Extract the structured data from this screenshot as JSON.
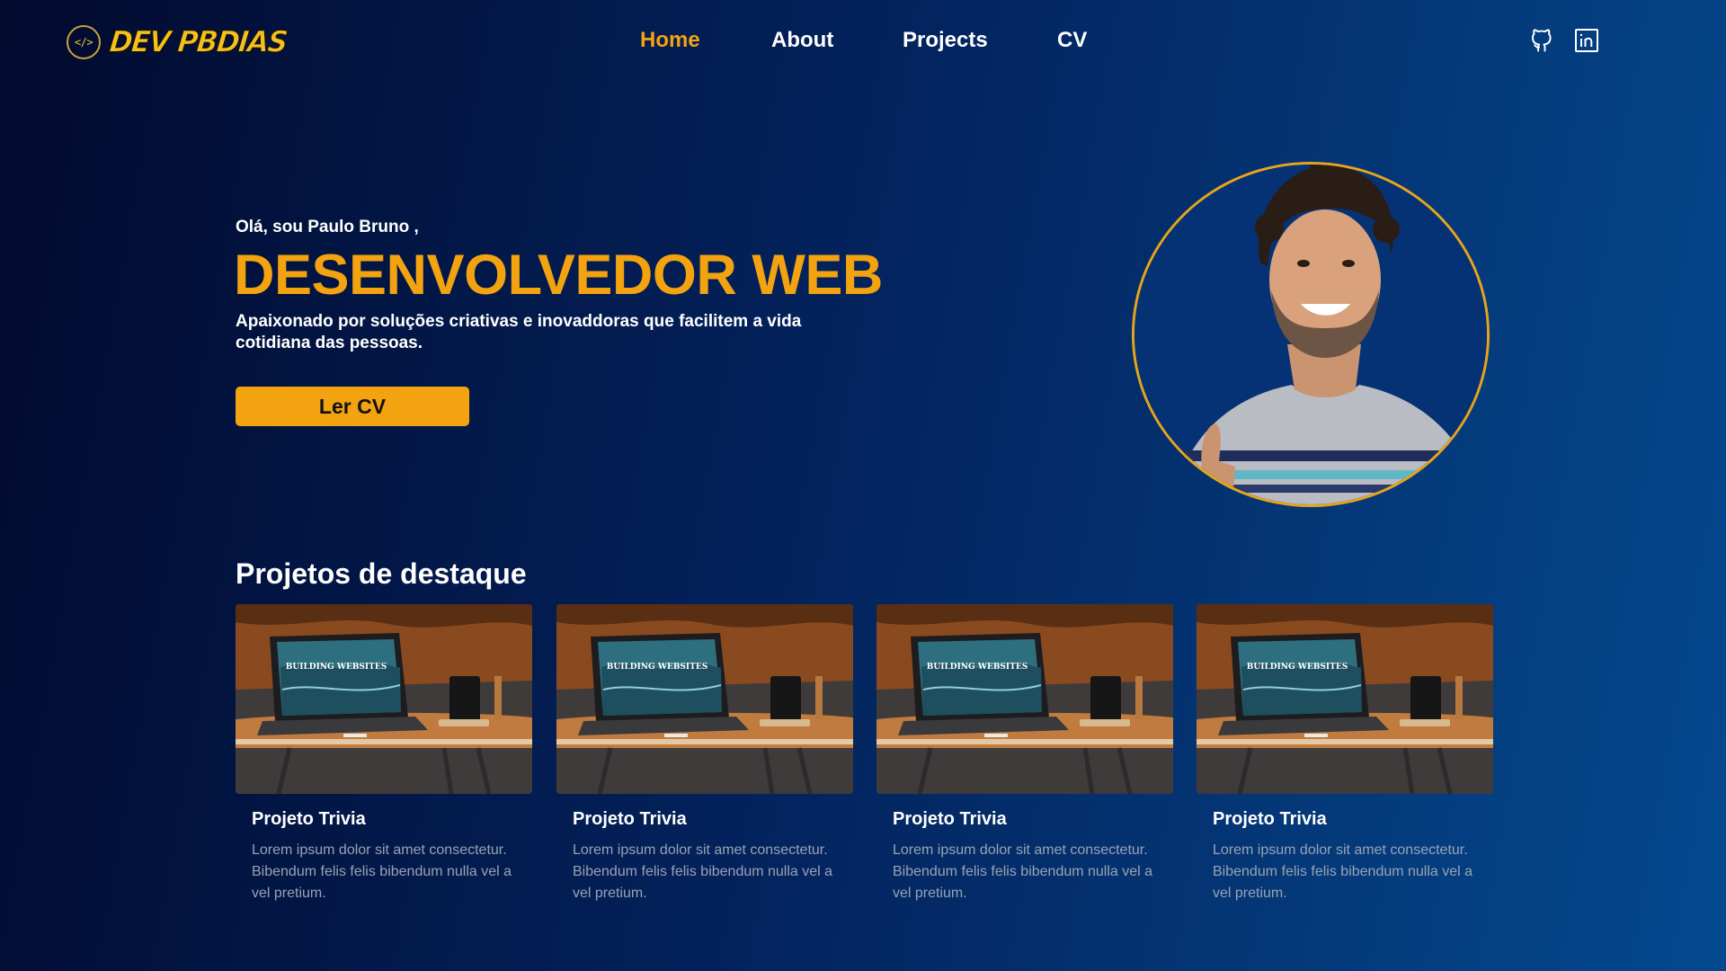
{
  "brand": {
    "logo_glyph": "</>",
    "logo_text": "DEV PBDIAS"
  },
  "nav": {
    "items": [
      {
        "label": "Home",
        "active": true
      },
      {
        "label": "About",
        "active": false
      },
      {
        "label": "Projects",
        "active": false
      },
      {
        "label": "CV",
        "active": false
      }
    ],
    "social": [
      {
        "icon": "github-icon"
      },
      {
        "icon": "linkedin-icon"
      }
    ]
  },
  "hero": {
    "greeting": "Olá, sou Paulo Bruno ,",
    "title": "DESENVOLVEDOR WEB",
    "description": "Apaixonado por soluções criativas e inovaddoras que facilitem a vida cotidiana das pessoas.",
    "cta_label": "Ler CV",
    "avatar_icon": "profile-photo"
  },
  "projects": {
    "heading": "Projetos de destaque",
    "cards": [
      {
        "title": "Projeto Trivia",
        "text": "Lorem ipsum dolor sit amet consectetur. Bibendum felis felis bibendum nulla vel a vel pretium.",
        "image_text": "BUILDING WEBSITES"
      },
      {
        "title": "Projeto Trivia",
        "text": "Lorem ipsum dolor sit amet consectetur. Bibendum felis felis bibendum nulla vel a vel pretium.",
        "image_text": "BUILDING WEBSITES"
      },
      {
        "title": "Projeto Trivia",
        "text": "Lorem ipsum dolor sit amet consectetur. Bibendum felis felis bibendum nulla vel a vel pretium.",
        "image_text": "BUILDING WEBSITES"
      },
      {
        "title": "Projeto Trivia",
        "text": "Lorem ipsum dolor sit amet consectetur. Bibendum felis felis bibendum nulla vel a vel pretium.",
        "image_text": "BUILDING WEBSITES"
      }
    ]
  },
  "colors": {
    "accent": "#f2a30f",
    "text": "#ffffff",
    "muted": "#9aa3b3",
    "bg_start": "#020a2e",
    "bg_end": "#04498f"
  }
}
